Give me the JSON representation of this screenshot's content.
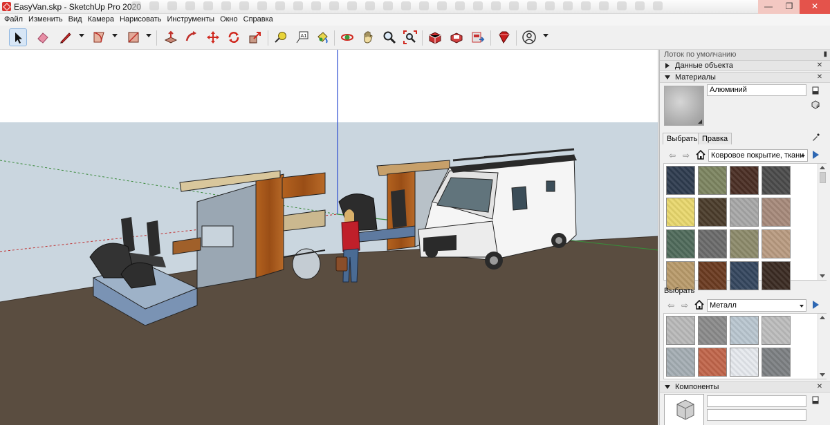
{
  "window": {
    "title": "EasyVan.skp - SketchUp Pro 2020",
    "minimize": "—",
    "maximize": "❐",
    "close": "✕"
  },
  "menu": [
    "Файл",
    "Изменить",
    "Вид",
    "Камера",
    "Нарисовать",
    "Инструменты",
    "Окно",
    "Справка"
  ],
  "toolbar": {
    "tools": [
      "select",
      "eraser",
      "line",
      "arc",
      "rectangle",
      "push-pull",
      "move",
      "rotate",
      "scale",
      "offset",
      "tape-measure",
      "text",
      "paint-bucket",
      "orbit",
      "pan",
      "zoom",
      "zoom-extents",
      "3d-warehouse",
      "extension-warehouse",
      "send-to-layout",
      "extension-manager",
      "account"
    ]
  },
  "tray": {
    "title": "Лоток по умолчанию",
    "pin": "₽",
    "panels": {
      "entity_info": "Данные объекта",
      "materials": "Материалы",
      "components": "Компоненты"
    },
    "materials": {
      "current_name": "Алюминий",
      "tab_select": "Выбрать",
      "tab_edit": "Правка",
      "collection_top": "Ковровое покрытие, ткани",
      "second_label": "Выбрать",
      "collection_bottom": "Металл",
      "swatches_top": [
        "#2e3b4e",
        "#7c8460",
        "#4a2e24",
        "#4a4a4a",
        "#e8d76c",
        "#4a3c2a",
        "#a7a7a7",
        "#a6897a",
        "#4f6a5a",
        "#6a6a6a",
        "#8c8a6a",
        "#b89a80",
        "#b89a6a",
        "#6a3a20",
        "#34465e",
        "#3a2a22"
      ],
      "swatches_bottom": [
        "#b9b9b9",
        "#8a8a8a",
        "#b9c6cf",
        "#bcbcbc",
        "#a4adb3",
        "#c0654a",
        "#e6e9ee",
        "#7c7f82"
      ]
    }
  }
}
